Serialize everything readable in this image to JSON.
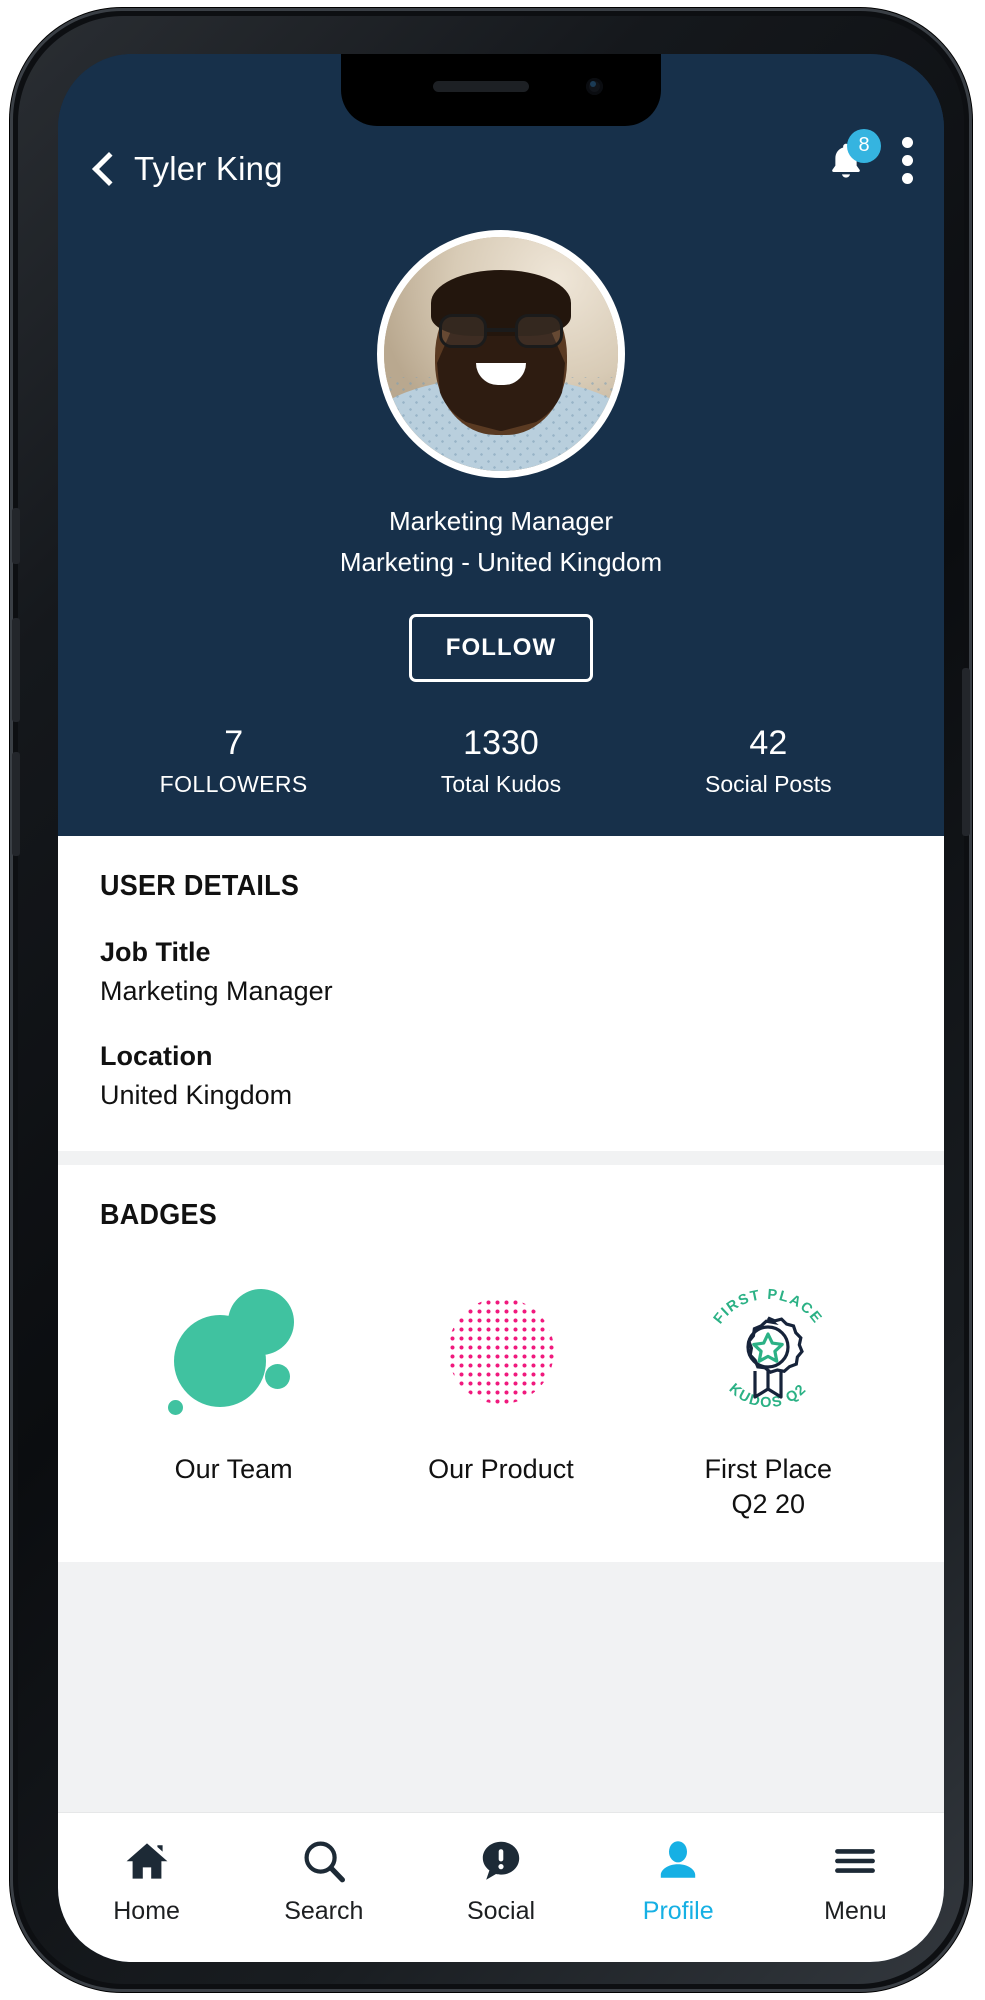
{
  "header": {
    "back_icon": "chevron-left-icon",
    "title": "Tyler King",
    "bell_icon": "notification-bell-icon",
    "notification_count": "8",
    "overflow_icon": "kebab-menu-icon"
  },
  "profile": {
    "avatar_alt": "avatar",
    "role": "Marketing Manager",
    "department_location": "Marketing - United Kingdom",
    "follow_label": "FOLLOW",
    "stats": [
      {
        "value": "7",
        "label": "FOLLOWERS"
      },
      {
        "value": "1330",
        "label": "Total Kudos"
      },
      {
        "value": "42",
        "label": "Social Posts"
      }
    ]
  },
  "user_details": {
    "section_title": "USER DETAILS",
    "fields": [
      {
        "label": "Job Title",
        "value": "Marketing Manager"
      },
      {
        "label": "Location",
        "value": "United Kingdom"
      }
    ]
  },
  "badges": {
    "section_title": "BADGES",
    "items": [
      {
        "caption": "Our Team",
        "art": "green-blob-badge-icon"
      },
      {
        "caption": "Our Product",
        "art": "pink-dotted-sphere-badge-icon"
      },
      {
        "caption": "First Place",
        "caption_line2": "Q2 20",
        "art": "first-place-rosette-badge-icon",
        "arc_top": "FIRST PLACE",
        "arc_bottom": "KUDOS Q2 "
      }
    ]
  },
  "bottom_nav": {
    "items": [
      {
        "label": "Home",
        "icon": "home-icon",
        "active": false
      },
      {
        "label": "Search",
        "icon": "search-icon",
        "active": false
      },
      {
        "label": "Social",
        "icon": "speech-bubble-icon",
        "active": false
      },
      {
        "label": "Profile",
        "icon": "person-icon",
        "active": true
      },
      {
        "label": "Menu",
        "icon": "hamburger-menu-icon",
        "active": false
      }
    ]
  },
  "colors": {
    "hero_background": "#17304a",
    "accent_cyan": "#16b0e4",
    "badge_cyan": "#35b4e0",
    "badge_green": "#40c2a0",
    "badge_pink": "#f0197d",
    "text_dark": "#111111"
  }
}
